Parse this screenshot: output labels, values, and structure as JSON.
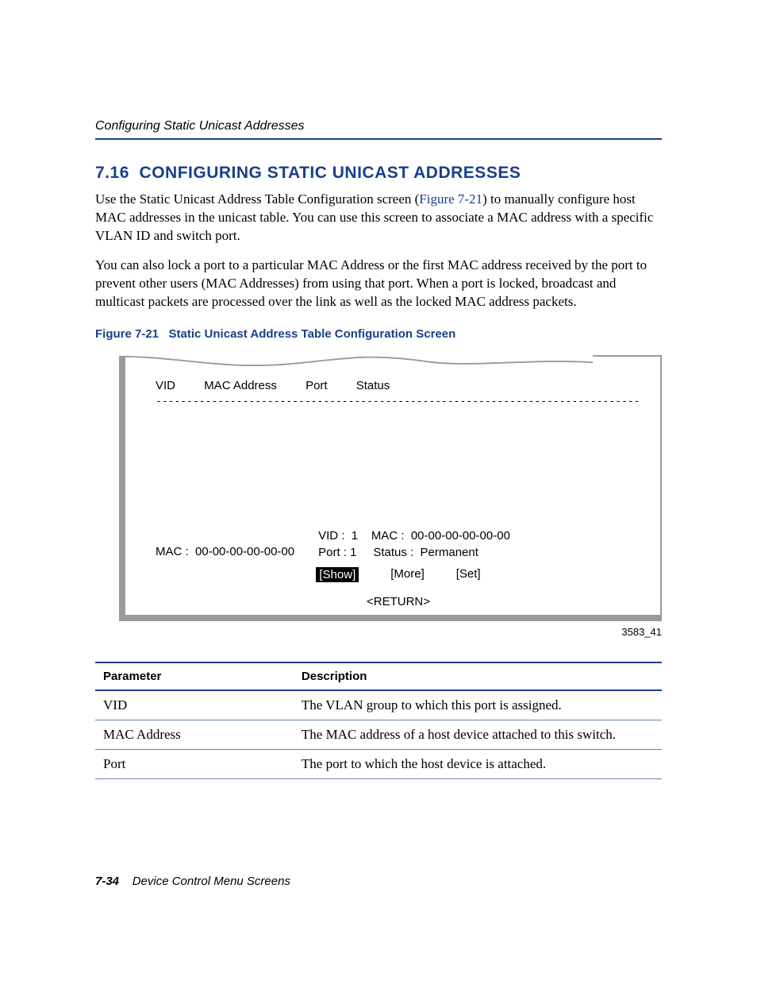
{
  "header": {
    "running_title": "Configuring Static Unicast Addresses"
  },
  "section": {
    "number": "7.16",
    "title": "CONFIGURING STATIC UNICAST ADDRESSES",
    "intro_pre": "Use the Static Unicast Address Table Configuration screen (",
    "intro_link": "Figure 7-21",
    "intro_post": ") to manually configure host MAC addresses in the unicast table. You can use this screen to associate a MAC address with a specific VLAN ID and switch port.",
    "para2": "You can also lock a port to a particular MAC Address or the first MAC address received by the port to prevent other users (MAC Addresses) from using that port. When a port is locked, broadcast and multicast packets are processed over the link as well as the locked MAC address packets."
  },
  "figure": {
    "label": "Figure 7-21",
    "title": "Static Unicast Address Table Configuration Screen",
    "id": "3583_41"
  },
  "terminal": {
    "columns": {
      "vid": "VID",
      "mac": "MAC Address",
      "port": "Port",
      "status": "Status"
    },
    "dashes": "---------------------------------------------------------------------------------------------------",
    "left_mac_label": "MAC  :",
    "left_mac_value": "00-00-00-00-00-00",
    "vid_label": "VID :",
    "vid_value": "1",
    "mac2_label": "MAC  :",
    "mac2_value": "00-00-00-00-00-00",
    "port_label": "Port :",
    "port_value": "1",
    "status_label": "Status  :",
    "status_value": "Permanent",
    "show": "[Show]",
    "more": "[More]",
    "set": "[Set]",
    "return": "<RETURN>"
  },
  "table": {
    "headers": {
      "param": "Parameter",
      "desc": "Description"
    },
    "rows": [
      {
        "param": "VID",
        "desc": "The VLAN group to which this port is assigned."
      },
      {
        "param": "MAC Address",
        "desc": "The MAC address of a host device attached to this switch."
      },
      {
        "param": "Port",
        "desc": "The port to which the host device is attached."
      }
    ]
  },
  "footer": {
    "page": "7-34",
    "title": "Device Control Menu Screens"
  }
}
